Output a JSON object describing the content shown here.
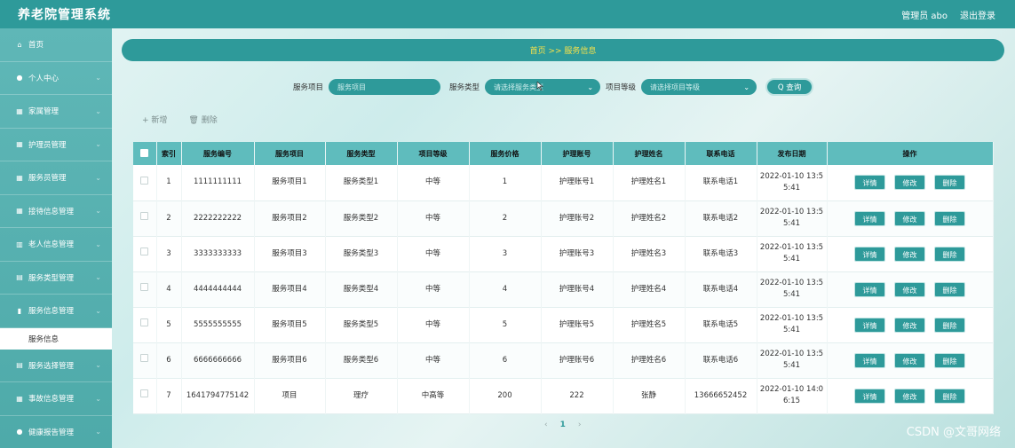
{
  "app": {
    "title": "养老院管理系统"
  },
  "header": {
    "user_label": "管理员 abo",
    "logout_label": "退出登录"
  },
  "sidebar": {
    "items": [
      {
        "icon": "home-icon",
        "glyph": "⌂",
        "label": "首页",
        "has_chev": false
      },
      {
        "icon": "user-icon",
        "glyph": "●",
        "label": "个人中心",
        "has_chev": true
      },
      {
        "icon": "grid-icon",
        "glyph": "▦",
        "label": "家属管理",
        "has_chev": true
      },
      {
        "icon": "grid-icon",
        "glyph": "▦",
        "label": "护理员管理",
        "has_chev": true
      },
      {
        "icon": "grid-icon",
        "glyph": "▦",
        "label": "服务员管理",
        "has_chev": true
      },
      {
        "icon": "grid-icon",
        "glyph": "▦",
        "label": "接待信息管理",
        "has_chev": true
      },
      {
        "icon": "building-icon",
        "glyph": "▥",
        "label": "老人信息管理",
        "has_chev": true
      },
      {
        "icon": "list-icon",
        "glyph": "▤",
        "label": "服务类型管理",
        "has_chev": true
      },
      {
        "icon": "chart-icon",
        "glyph": "▮",
        "label": "服务信息管理",
        "has_chev": true
      }
    ],
    "sub_active": "服务信息",
    "items_after": [
      {
        "icon": "list-icon",
        "glyph": "▤",
        "label": "服务选择管理",
        "has_chev": true
      },
      {
        "icon": "grid-icon",
        "glyph": "▦",
        "label": "事故信息管理",
        "has_chev": true
      },
      {
        "icon": "heart-icon",
        "glyph": "●",
        "label": "健康报告管理",
        "has_chev": true
      }
    ]
  },
  "breadcrumb": "首页 >> 服务信息",
  "search": {
    "item_label": "服务项目",
    "item_placeholder": "服务项目",
    "type_label": "服务类型",
    "type_placeholder": "请选择服务类型",
    "level_label": "项目等级",
    "level_placeholder": "请选择项目等级",
    "query_label": "Q 查询"
  },
  "toolbar": {
    "add_label": "+ 新增",
    "delete_label": "删除"
  },
  "table": {
    "columns": [
      "索引",
      "服务编号",
      "服务项目",
      "服务类型",
      "项目等级",
      "服务价格",
      "护理账号",
      "护理姓名",
      "联系电话",
      "发布日期",
      "操作"
    ],
    "rows": [
      {
        "idx": "1",
        "code": "1111111111",
        "item": "服务项目1",
        "type": "服务类型1",
        "level": "中等",
        "price": "1",
        "acct": "护理账号1",
        "name": "护理姓名1",
        "phone": "联系电话1",
        "date1": "2022-01-10 13:5",
        "date2": "5:41"
      },
      {
        "idx": "2",
        "code": "2222222222",
        "item": "服务项目2",
        "type": "服务类型2",
        "level": "中等",
        "price": "2",
        "acct": "护理账号2",
        "name": "护理姓名2",
        "phone": "联系电话2",
        "date1": "2022-01-10 13:5",
        "date2": "5:41"
      },
      {
        "idx": "3",
        "code": "3333333333",
        "item": "服务项目3",
        "type": "服务类型3",
        "level": "中等",
        "price": "3",
        "acct": "护理账号3",
        "name": "护理姓名3",
        "phone": "联系电话3",
        "date1": "2022-01-10 13:5",
        "date2": "5:41"
      },
      {
        "idx": "4",
        "code": "4444444444",
        "item": "服务项目4",
        "type": "服务类型4",
        "level": "中等",
        "price": "4",
        "acct": "护理账号4",
        "name": "护理姓名4",
        "phone": "联系电话4",
        "date1": "2022-01-10 13:5",
        "date2": "5:41"
      },
      {
        "idx": "5",
        "code": "5555555555",
        "item": "服务项目5",
        "type": "服务类型5",
        "level": "中等",
        "price": "5",
        "acct": "护理账号5",
        "name": "护理姓名5",
        "phone": "联系电话5",
        "date1": "2022-01-10 13:5",
        "date2": "5:41"
      },
      {
        "idx": "6",
        "code": "6666666666",
        "item": "服务项目6",
        "type": "服务类型6",
        "level": "中等",
        "price": "6",
        "acct": "护理账号6",
        "name": "护理姓名6",
        "phone": "联系电话6",
        "date1": "2022-01-10 13:5",
        "date2": "5:41"
      },
      {
        "idx": "7",
        "code": "1641794775142",
        "item": "项目",
        "type": "理疗",
        "level": "中高等",
        "price": "200",
        "acct": "222",
        "name": "张静",
        "phone": "13666652452",
        "date1": "2022-01-10 14:0",
        "date2": "6:15"
      }
    ],
    "op_labels": {
      "detail": "详情",
      "edit": "修改",
      "delete": "删除"
    }
  },
  "pager": {
    "prev": "‹",
    "current": "1",
    "next": "›"
  },
  "watermark": "CSDN @文哥网络",
  "colors": {
    "primary": "#2e9a9a",
    "header_row": "#5fbcbd",
    "breadcrumb_text": "#f7e14a"
  }
}
